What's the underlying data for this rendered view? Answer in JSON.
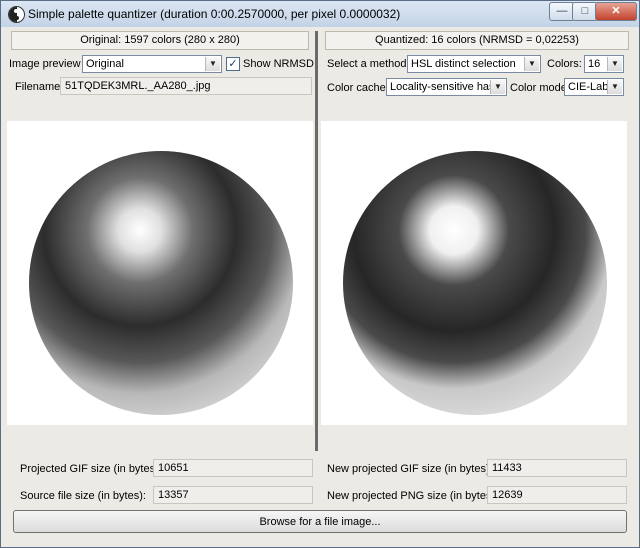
{
  "window": {
    "title": "Simple palette quantizer (duration 0:00.2570000, per pixel 0.0000032)"
  },
  "titlebar_buttons": {
    "minimize": "—",
    "maximize": "□",
    "close": "✕"
  },
  "left": {
    "header": "Original: 1597 colors (280 x 280)",
    "preview_label": "Image preview",
    "preview_value": "Original",
    "show_nrmsd_label": "Show NRMSD",
    "show_nrmsd_checked": "✓",
    "filename_label": "Filename",
    "filename_value": "51TQDEK3MRL._AA280_.jpg"
  },
  "right": {
    "header": "Quantized: 16 colors (NRMSD = 0,02253)",
    "method_label": "Select a method:",
    "method_value": "HSL distinct selection",
    "colors_label": "Colors:",
    "colors_value": "16",
    "cache_label": "Color cache:",
    "cache_value": "Locality-sensitive hash",
    "model_label": "Color model",
    "model_value": "CIE-Lab"
  },
  "stats": {
    "gif_label": "Projected GIF size (in bytes):",
    "gif_value": "10651",
    "source_label": "Source file size (in bytes):",
    "source_value": "13357",
    "new_gif_label": "New projected GIF size (in bytes):",
    "new_gif_value": "11433",
    "new_png_label": "New projected PNG size (in bytes):",
    "new_png_value": "12639"
  },
  "browse_label": "Browse for a file image...",
  "icons": {
    "dropdown": "▼"
  }
}
